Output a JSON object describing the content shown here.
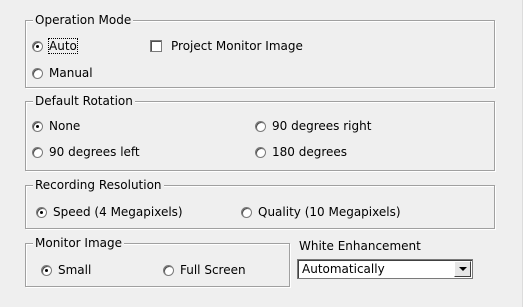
{
  "operation_mode": {
    "title": "Operation Mode",
    "auto_label": "Auto",
    "auto_selected": true,
    "manual_label": "Manual",
    "manual_selected": false,
    "project_monitor_label": "Project Monitor Image",
    "project_monitor_checked": false
  },
  "default_rotation": {
    "title": "Default Rotation",
    "options": [
      {
        "label": "None",
        "selected": true
      },
      {
        "label": "90 degrees right",
        "selected": false
      },
      {
        "label": "90 degrees left",
        "selected": false
      },
      {
        "label": "180 degrees",
        "selected": false
      }
    ]
  },
  "recording_resolution": {
    "title": "Recording Resolution",
    "options": [
      {
        "label": "Speed (4 Megapixels)",
        "selected": true
      },
      {
        "label": "Quality (10 Megapixels)",
        "selected": false
      }
    ]
  },
  "monitor_image": {
    "title": "Monitor Image",
    "options": [
      {
        "label": "Small",
        "selected": true
      },
      {
        "label": "Full Screen",
        "selected": false
      }
    ]
  },
  "white_enhancement": {
    "label": "White Enhancement",
    "value": "Automatically"
  }
}
